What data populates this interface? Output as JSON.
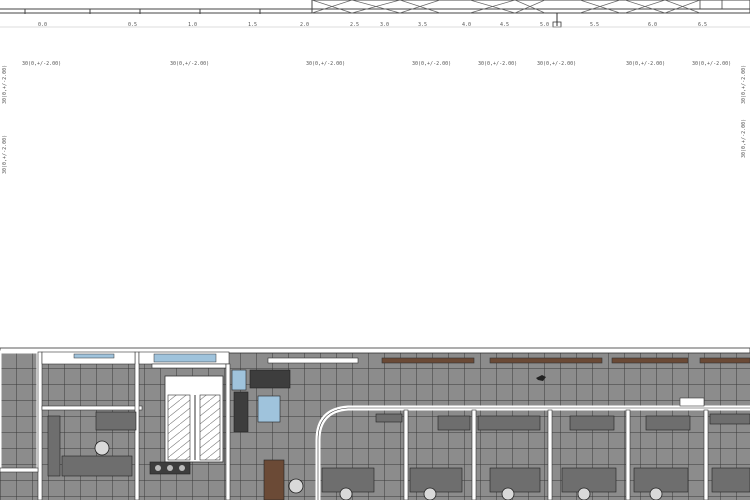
{
  "drawing": {
    "annotations": [
      "30(0,+/-2.00)",
      "30(0,+/-2.00)",
      "30(0,+/-2.00)",
      "30(0,+/-2.00)",
      "30(0,+/-2.00)",
      "30(0,+/-2.00)",
      "30(0,+/-2.00)",
      "30(0,+/-2.00)"
    ],
    "side_annotations": [
      "30(0,+/-2.00)",
      "30(0,+/-2.00)",
      "30(0,+/-2.00)",
      "30(0,+/-2.00)"
    ],
    "ruler_marks": [
      "0.0",
      "0.5",
      "1.0",
      "1.5",
      "2.0",
      "2.5",
      "3.0",
      "3.5",
      "4.0",
      "4.5",
      "5.0",
      "5.5",
      "6.0",
      "6.5"
    ],
    "colors": {
      "floor": "#8c8c8c",
      "tile_grid": "#3a3a3a",
      "wall": "#ffffff",
      "furniture": "#6e6e6e",
      "furniture_dark": "#3d3d3d",
      "glass": "#9fc3dc",
      "wood": "#6b4a36"
    }
  }
}
